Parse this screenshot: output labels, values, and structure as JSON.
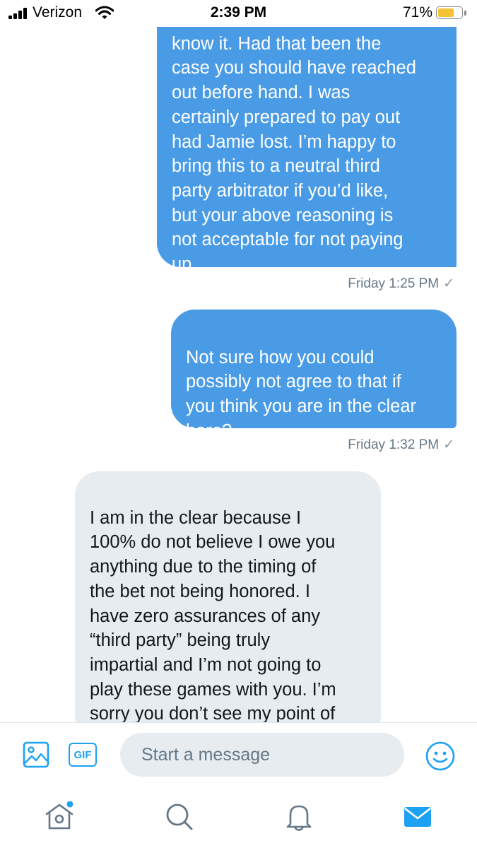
{
  "status_bar": {
    "carrier": "Verizon",
    "time": "2:39 PM",
    "battery_percent_label": "71%",
    "battery_level": 0.71,
    "icons": [
      "signal-icon",
      "wifi-icon",
      "battery-icon"
    ]
  },
  "conversation": {
    "messages": [
      {
        "direction": "sent",
        "text": "know it. Had that been the\ncase you should have reached\nout before hand. I was\ncertainly prepared to pay out\nhad Jamie lost. I’m happy to\nbring this to a neutral third\nparty arbitrator if you’d like,\nbut your above reasoning is\nnot acceptable for not paying\nup.",
        "timestamp": "Friday 1:25 PM",
        "status_icon": "check-icon"
      },
      {
        "direction": "sent",
        "text": "Not sure how you could\npossibly not agree to that if\nyou think you are in the clear\nhere?",
        "timestamp": "Friday 1:32 PM",
        "status_icon": "check-icon"
      },
      {
        "direction": "received",
        "text": "I am in the clear because I\n100% do not believe I owe you\nanything due to the timing of\nthe bet not being honored. I\nhave zero assurances of any\n“third party” being truly\nimpartial and I’m not going to\nplay these games with you. I’m\nsorry you don’t see my point of\nview and I don’t see yours but"
      }
    ]
  },
  "composer": {
    "placeholder": "Start a message",
    "gif_label": "GIF",
    "icons": [
      "image-icon",
      "gif-icon",
      "emoji-icon"
    ]
  },
  "tab_bar": {
    "items": [
      "home-icon",
      "search-icon",
      "notifications-icon",
      "messages-icon"
    ],
    "home_has_unread_dot": true
  },
  "colors": {
    "accent": "#1da1f2",
    "sent_bubble": "#4a9be6",
    "received_bubble": "#e6ecf0",
    "meta_text": "#657786",
    "battery_fill": "#f5c232"
  }
}
